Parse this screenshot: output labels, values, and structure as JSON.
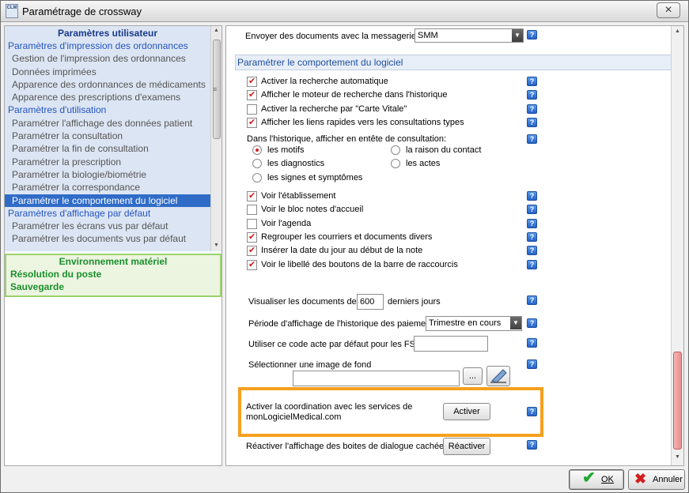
{
  "window": {
    "title": "Paramétrage de crossway",
    "app_icon_text": "CLM",
    "close_label": "×"
  },
  "nav": {
    "header": "Paramètres utilisateur",
    "items": [
      {
        "label": "Paramètres d'impression des ordonnances",
        "kind": "cat"
      },
      {
        "label": "Gestion de l'impression des ordonnances",
        "kind": "sub"
      },
      {
        "label": "Données imprimées",
        "kind": "sub"
      },
      {
        "label": "Apparence des ordonnances de médicaments",
        "kind": "sub"
      },
      {
        "label": "Apparence des prescriptions d'examens",
        "kind": "sub"
      },
      {
        "label": "Paramètres d'utilisation",
        "kind": "cat"
      },
      {
        "label": "Paramétrer l'affichage des données patient",
        "kind": "sub"
      },
      {
        "label": "Paramétrer la consultation",
        "kind": "sub"
      },
      {
        "label": "Paramétrer la fin de consultation",
        "kind": "sub"
      },
      {
        "label": "Paramétrer la prescription",
        "kind": "sub"
      },
      {
        "label": "Paramétrer la biologie/biométrie",
        "kind": "sub"
      },
      {
        "label": "Paramétrer la correspondance",
        "kind": "sub"
      },
      {
        "label": "Paramétrer le comportement du logiciel",
        "kind": "sub",
        "selected": true
      },
      {
        "label": "Paramètres d'affichage par défaut",
        "kind": "cat"
      },
      {
        "label": "Paramétrer les écrans vus par défaut",
        "kind": "sub"
      },
      {
        "label": "Paramétrer les documents vus par défaut",
        "kind": "sub"
      }
    ]
  },
  "env": {
    "header": "Environnement matériel",
    "items": [
      "Résolution du poste",
      "Sauvegarde"
    ]
  },
  "content": {
    "messaging_label": "Envoyer des documents avec la messagerie :",
    "messaging_value": "SMM",
    "section_title": "Paramétrer le comportement du logiciel",
    "checkboxes_a": [
      {
        "label": "Activer la recherche automatique",
        "checked": true
      },
      {
        "label": "Afficher le moteur de recherche dans l'historique",
        "checked": true
      },
      {
        "label": "Activer la recherche par \"Carte Vitale\"",
        "checked": false
      },
      {
        "label": "Afficher les liens rapides vers les consultations types",
        "checked": true
      }
    ],
    "history_header_label": "Dans l'historique, afficher en entête de consultation:",
    "radios": [
      {
        "label": "les motifs",
        "on": true
      },
      {
        "label": "la raison du contact",
        "on": false
      },
      {
        "label": "les diagnostics",
        "on": false
      },
      {
        "label": "les actes",
        "on": false
      },
      {
        "label": "les signes et symptômes",
        "on": false
      }
    ],
    "checkboxes_b": [
      {
        "label": "Voir l'établissement",
        "checked": true
      },
      {
        "label": "Voir le bloc notes d'accueil",
        "checked": false
      },
      {
        "label": "Voir l'agenda",
        "checked": false
      },
      {
        "label": "Regrouper les courriers et documents divers",
        "checked": true
      },
      {
        "label": "Insérer la date du jour au début de la note",
        "checked": true
      },
      {
        "label": "Voir le libellé des boutons de la barre de raccourcis",
        "checked": true
      }
    ],
    "docs_label_before": "Visualiser les documents des",
    "docs_days": "600",
    "docs_label_after": "derniers jours",
    "history_period_label": "Période d'affichage de l'historique des paiements",
    "history_period_value": "Trimestre en cours",
    "fse_label": "Utiliser ce code acte par défaut pour les FSE",
    "fse_value": "",
    "bg_image_label": "Sélectionner une image de fond",
    "bg_image_value": "",
    "browse_label": "...",
    "coord_label_1": "Activer la coordination avec les services de",
    "coord_label_2": "monLogicielMedical.com",
    "activate_label": "Activer",
    "reactivate_text": "Réactiver l'affichage des boites de dialogue cachées",
    "reactivate_label": "Réactiver",
    "help_label": "?"
  },
  "footer": {
    "ok_label": "OK",
    "cancel_label": "Annuler"
  }
}
